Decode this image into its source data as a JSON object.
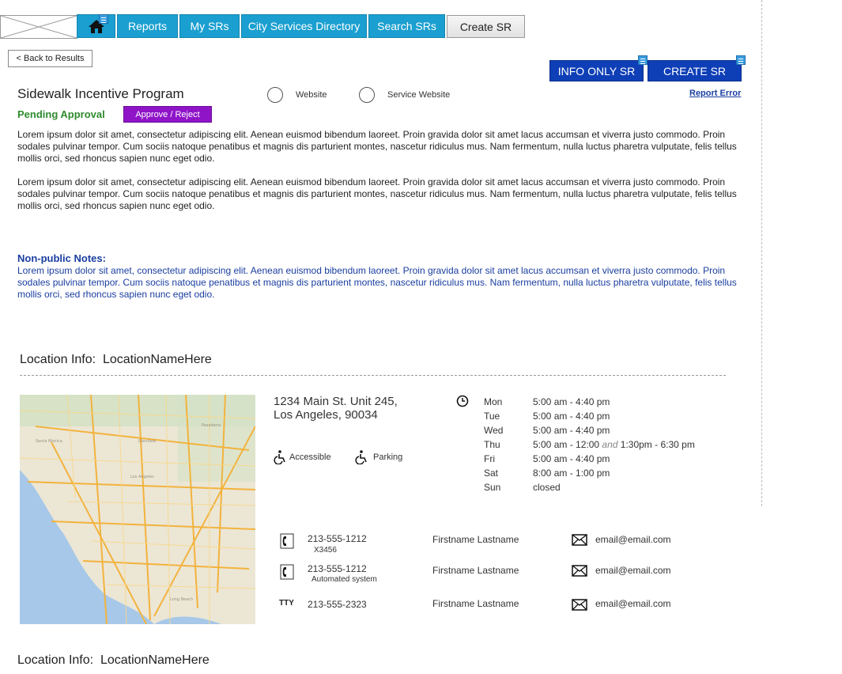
{
  "nav": {
    "home_icon": "home-icon",
    "tabs": [
      {
        "label": "Reports"
      },
      {
        "label": "My SRs"
      },
      {
        "label": "City Services Directory"
      },
      {
        "label": "Search SRs"
      }
    ],
    "create_label": "Create SR"
  },
  "back_label": "< Back to Results",
  "actions": {
    "info_only": "INFO ONLY SR",
    "create": "CREATE SR",
    "report_error": "Report Error"
  },
  "program": {
    "title": "Sidewalk Incentive Program",
    "status": "Pending Approval",
    "approve_label": "Approve / Reject",
    "radio_website": "Website",
    "radio_service_website": "Service Website",
    "desc1": "Lorem ipsum dolor sit amet, consectetur adipiscing elit. Aenean euismod bibendum laoreet. Proin gravida dolor sit amet lacus accumsan et viverra justo commodo. Proin sodales pulvinar tempor. Cum sociis natoque penatibus et magnis dis parturient montes, nascetur ridiculus mus. Nam fermentum, nulla luctus pharetra vulputate, felis tellus mollis orci, sed rhoncus sapien nunc eget odio.",
    "desc2": "Lorem ipsum dolor sit amet, consectetur adipiscing elit. Aenean euismod bibendum laoreet. Proin gravida dolor sit amet lacus accumsan et viverra justo commodo. Proin sodales pulvinar tempor. Cum sociis natoque penatibus et magnis dis parturient montes, nascetur ridiculus mus. Nam fermentum, nulla luctus pharetra vulputate, felis tellus mollis orci, sed rhoncus sapien nunc eget odio."
  },
  "notes": {
    "title": "Non-public Notes:",
    "text": "Lorem ipsum dolor sit amet, consectetur adipiscing elit. Aenean euismod bibendum laoreet. Proin gravida dolor sit amet lacus accumsan et viverra justo commodo. Proin sodales pulvinar tempor. Cum sociis natoque penatibus et magnis dis parturient montes, nascetur ridiculus mus. Nam fermentum, nulla luctus pharetra vulputate, felis tellus mollis orci, sed rhoncus sapien nunc eget odio."
  },
  "location": {
    "heading": "Location Info:  LocationNameHere",
    "address_line1": "1234 Main St. Unit 245,",
    "address_line2": "Los Angeles, 90034",
    "features": [
      "Accessible",
      "Parking"
    ],
    "hours": [
      {
        "day": "Mon",
        "time": "5:00 am - 4:40 pm"
      },
      {
        "day": "Tue",
        "time": "5:00 am - 4:40 pm"
      },
      {
        "day": "Wed",
        "time": "5:00 am - 4:40 pm"
      },
      {
        "day": "Thu",
        "time_a": "5:00 am - 12:00",
        "and": "and",
        "time_b": "1:30pm - 6:30 pm"
      },
      {
        "day": "Fri",
        "time": "5:00 am - 4:40 pm"
      },
      {
        "day": "Sat",
        "time": "8:00 am - 1:00 pm"
      },
      {
        "day": "Sun",
        "time": "closed"
      }
    ],
    "contacts": [
      {
        "icon": "phone-icon",
        "phone": "213-555-1212",
        "sub": "X3456",
        "name": "Firstname Lastname",
        "email": "email@email.com"
      },
      {
        "icon": "phone-icon",
        "phone": "213-555-1212",
        "sub": "Automated system",
        "name": "Firstname Lastname",
        "email": "email@email.com"
      },
      {
        "icon": "tty-label",
        "tty": "TTY",
        "phone": "213-555-2323",
        "name": "Firstname Lastname",
        "email": "email@email.com"
      }
    ]
  },
  "location2": {
    "heading": "Location Info:  LocationNameHere"
  }
}
